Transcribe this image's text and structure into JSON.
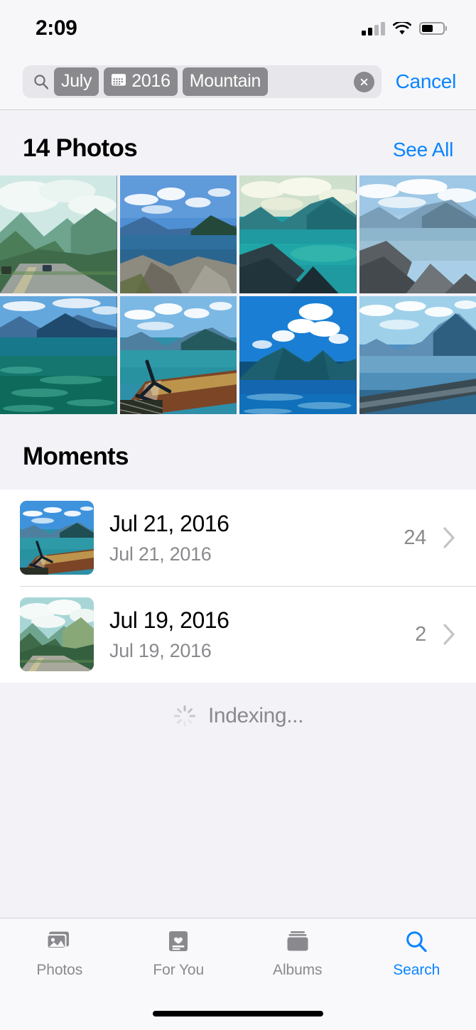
{
  "status_bar": {
    "time": "2:09",
    "cellular_icon": "cellular-bars-icon",
    "wifi_icon": "wifi-icon",
    "battery_icon": "battery-icon",
    "battery_level_percent": 52
  },
  "search": {
    "search_icon": "search-icon",
    "clear_icon": "clear-circle-icon",
    "cancel_label": "Cancel",
    "tokens": [
      {
        "label": "July",
        "icon": null
      },
      {
        "label": "2016",
        "icon": "calendar-icon"
      },
      {
        "label": "Mountain",
        "icon": null
      }
    ]
  },
  "photos_section": {
    "title": "14 Photos",
    "see_all_label": "See All",
    "count": 14,
    "tiles": [
      {
        "alt": "mountain-road-valley",
        "sky": "#cfe8e4",
        "mid": "#7fb8a8",
        "land": "#3f6b4a",
        "road": "#9aa09a"
      },
      {
        "alt": "lake-rocky-shore",
        "sky": "#4f8fd4",
        "mid": "#3b6fa8",
        "land": "#1f4a72",
        "road": "#8d8a80"
      },
      {
        "alt": "teal-lake-cliffs",
        "sky": "#d9e6cf",
        "mid": "#1e9aa0",
        "land": "#12585f",
        "road": "#2a3d47"
      },
      {
        "alt": "blue-lake-rocks",
        "sky": "#a9cfe8",
        "mid": "#7fa8c4",
        "land": "#4a6b80",
        "road": "#6b6f70"
      },
      {
        "alt": "calm-blue-water",
        "sky": "#63a7dd",
        "mid": "#1d7fa8",
        "land": "#14586b",
        "road": "#0d6b60"
      },
      {
        "alt": "boat-deck-lake",
        "sky": "#7cb8e4",
        "mid": "#2e8fa8",
        "land": "#1c6b7a",
        "road": "#6b3a22"
      },
      {
        "alt": "island-clouds-lake",
        "sky": "#1a7fd4",
        "mid": "#1466b0",
        "land": "#1b5f6b",
        "road": "#0f4f7a"
      },
      {
        "alt": "lake-railing-view",
        "sky": "#9fd0ea",
        "mid": "#4f8fc4",
        "land": "#2a5f80",
        "road": "#3a4a52"
      }
    ]
  },
  "moments_section": {
    "title": "Moments",
    "rows": [
      {
        "title": "Jul 21, 2016",
        "subtitle": "Jul 21, 2016",
        "count": "24",
        "chevron_icon": "chevron-right-icon",
        "thumb_alt": "boat-deck-lake-thumb"
      },
      {
        "title": "Jul 19, 2016",
        "subtitle": "Jul 19, 2016",
        "count": "2",
        "chevron_icon": "chevron-right-icon",
        "thumb_alt": "mountain-road-thumb"
      }
    ]
  },
  "indexing": {
    "label": "Indexing...",
    "spinner_icon": "activity-spinner-icon"
  },
  "tab_bar": {
    "active_index": 3,
    "items": [
      {
        "label": "Photos",
        "icon": "photos-stack-icon"
      },
      {
        "label": "For You",
        "icon": "for-you-card-icon"
      },
      {
        "label": "Albums",
        "icon": "albums-stack-icon"
      },
      {
        "label": "Search",
        "icon": "search-magnifier-icon"
      }
    ]
  },
  "colors": {
    "accent_blue": "#0a84ff",
    "token_gray": "#8a8a8e",
    "page_bg": "#f2f2f7",
    "list_bg": "#ffffff",
    "secondary_text": "#8a8a8e"
  }
}
